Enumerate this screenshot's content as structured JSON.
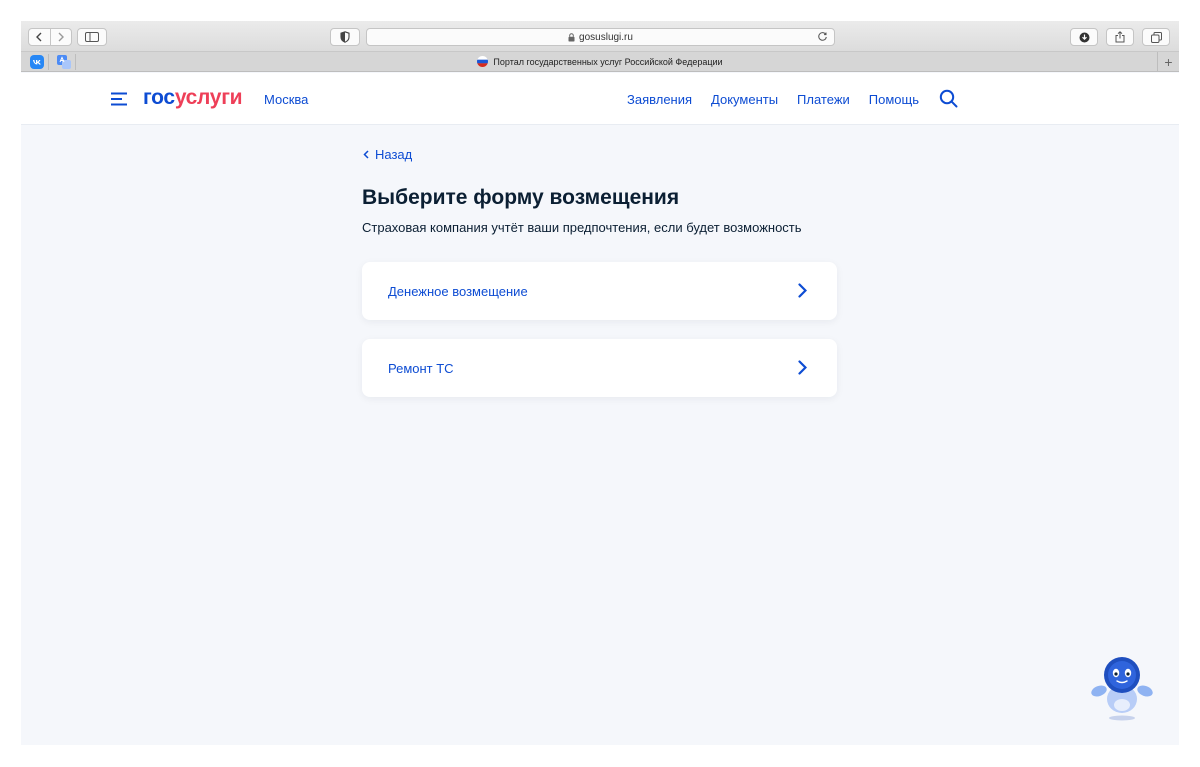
{
  "browser": {
    "address": "gosuslugi.ru",
    "tab_title": "Портал государственных услуг Российской Федерации"
  },
  "header": {
    "logo_part1": "гос",
    "logo_part2": "услуги",
    "city": "Москва",
    "nav": [
      "Заявления",
      "Документы",
      "Платежи",
      "Помощь"
    ]
  },
  "main": {
    "back_label": "Назад",
    "title": "Выберите форму возмещения",
    "subtitle": "Страховая компания учтёт ваши предпочтения, если будет возможность",
    "options": [
      {
        "label": "Денежное возмещение"
      },
      {
        "label": "Ремонт ТС"
      }
    ]
  },
  "colors": {
    "brand_blue": "#0d4cd3",
    "brand_red": "#ee3f58",
    "text_dark": "#0b1f33",
    "page_bg": "#f5f7fb"
  }
}
